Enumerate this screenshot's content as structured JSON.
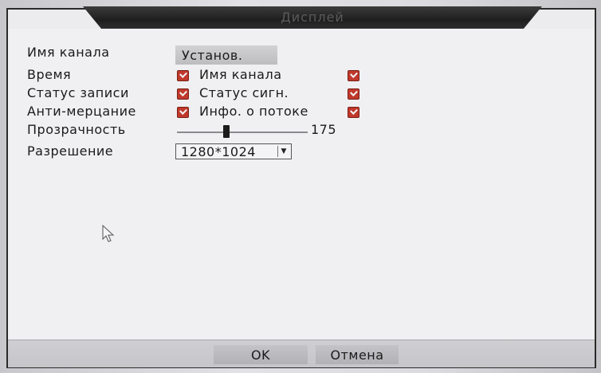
{
  "dialog": {
    "title": "Дисплей"
  },
  "settings": {
    "channel_name_label": "Имя канала",
    "set_button": "Установ.",
    "time_label": "Время",
    "time_checked": true,
    "overlay_channel_name_label": "Имя канала",
    "overlay_channel_name_checked": true,
    "record_status_label": "Статус записи",
    "record_status_checked": true,
    "alarm_status_label": "Статус сигн.",
    "alarm_status_checked": true,
    "anti_flicker_label": "Анти-мерцание",
    "anti_flicker_checked": true,
    "stream_info_label": "Инфо. о потоке",
    "stream_info_checked": true,
    "transparency_label": "Прозрачность",
    "transparency_value": "175",
    "resolution_label": "Разрешение",
    "resolution_value": "1280*1024"
  },
  "footer": {
    "ok_label": "OK",
    "cancel_label": "Отмена"
  },
  "colors": {
    "checkbox": "#c0392b",
    "title_bar": "#2a2a2a"
  },
  "icons": {
    "checkbox": "checkmark-icon",
    "dropdown": "chevron-down-icon",
    "cursor": "mouse-pointer-icon"
  }
}
